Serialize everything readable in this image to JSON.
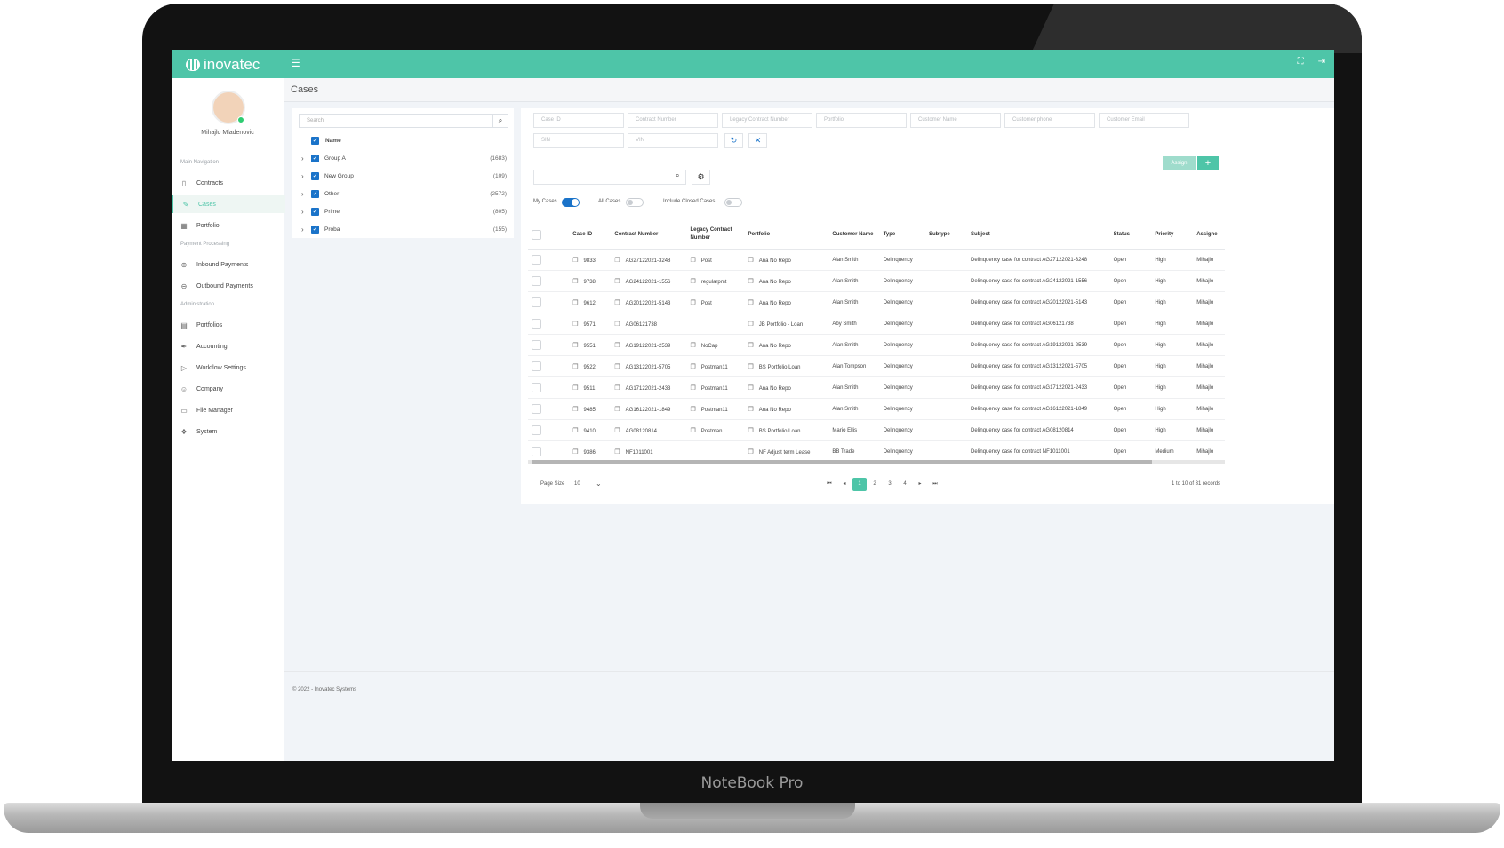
{
  "device": {
    "brand_label": "NoteBook Pro"
  },
  "app": {
    "logo": "inovatec",
    "page_title": "Cases",
    "footer": "© 2022 - Inovatec Systems"
  },
  "user": {
    "name": "Mihajlo Mladenovic"
  },
  "sidebar": {
    "sections": [
      {
        "title": "Main Navigation",
        "items": [
          {
            "label": "Contracts",
            "icon": "document-icon"
          },
          {
            "label": "Cases",
            "icon": "edit-icon"
          },
          {
            "label": "Portfolio",
            "icon": "grid-icon"
          }
        ]
      },
      {
        "title": "Payment Processing",
        "items": [
          {
            "label": "Inbound Payments",
            "icon": "plus-circle-icon"
          },
          {
            "label": "Outbound Payments",
            "icon": "minus-circle-icon"
          }
        ]
      },
      {
        "title": "Administration",
        "items": [
          {
            "label": "Portfolios",
            "icon": "folder-icon"
          },
          {
            "label": "Accounting",
            "icon": "pen-icon"
          },
          {
            "label": "Workflow Settings",
            "icon": "play-icon"
          },
          {
            "label": "Company",
            "icon": "people-icon"
          },
          {
            "label": "File Manager",
            "icon": "folder-open-icon"
          },
          {
            "label": "System",
            "icon": "tag-icon"
          }
        ]
      }
    ]
  },
  "tree": {
    "search_placeholder": "Search",
    "header": "Name",
    "groups": [
      {
        "name": "Group A",
        "count": "(1683)"
      },
      {
        "name": "New Group",
        "count": "(109)"
      },
      {
        "name": "Other",
        "count": "(2572)"
      },
      {
        "name": "Prime",
        "count": "(805)"
      },
      {
        "name": "Proba",
        "count": "(155)"
      }
    ]
  },
  "filters": {
    "case_id": "Case ID",
    "contract_number": "Contract Number",
    "legacy_contract_number": "Legacy Contract Number",
    "portfolio": "Portfolio",
    "customer_name": "Customer Name",
    "customer_phone": "Customer phone",
    "customer_email": "Customer Email",
    "sin": "SIN",
    "vin": "VIN"
  },
  "actions": {
    "assign": "Assign",
    "add": "+"
  },
  "toggles": {
    "my_cases": "My Cases",
    "all_cases": "All Cases",
    "include_closed": "Include Closed Cases"
  },
  "table": {
    "columns": [
      "Case ID",
      "Contract Number",
      "Legacy Contract Number",
      "Portfolio",
      "Customer Name",
      "Type",
      "Subtype",
      "Subject",
      "Status",
      "Priority",
      "Assigne"
    ],
    "rows": [
      {
        "id": "9833",
        "contract": "AG27122021-3248",
        "legacy": "Post",
        "portfolio": "Ana No Repo",
        "customer": "Alan Smith",
        "type": "Delinquency",
        "subtype": "",
        "subject": "Delinquency case for contract AG27122021-3248",
        "status": "Open",
        "priority": "High",
        "assignee": "Mihajlo"
      },
      {
        "id": "9738",
        "contract": "AG24122021-1556",
        "legacy": "regularpmt",
        "portfolio": "Ana No Repo",
        "customer": "Alan Smith",
        "type": "Delinquency",
        "subtype": "",
        "subject": "Delinquency case for contract AG24122021-1556",
        "status": "Open",
        "priority": "High",
        "assignee": "Mihajlo"
      },
      {
        "id": "9612",
        "contract": "AG20122021-5143",
        "legacy": "Post",
        "portfolio": "Ana No Repo",
        "customer": "Alan Smith",
        "type": "Delinquency",
        "subtype": "",
        "subject": "Delinquency case for contract AG20122021-5143",
        "status": "Open",
        "priority": "High",
        "assignee": "Mihajlo"
      },
      {
        "id": "9571",
        "contract": "AG06121738",
        "legacy": "",
        "portfolio": "JB Portfolio - Loan",
        "customer": "Aby Smith",
        "type": "Delinquency",
        "subtype": "",
        "subject": "Delinquency case for contract AG06121738",
        "status": "Open",
        "priority": "High",
        "assignee": "Mihajlo"
      },
      {
        "id": "9551",
        "contract": "AG19122021-2539",
        "legacy": "NoCap",
        "portfolio": "Ana No Repo",
        "customer": "Alan Smith",
        "type": "Delinquency",
        "subtype": "",
        "subject": "Delinquency case for contract AG19122021-2539",
        "status": "Open",
        "priority": "High",
        "assignee": "Mihajlo"
      },
      {
        "id": "9522",
        "contract": "AG13122021-5705",
        "legacy": "Postman11",
        "portfolio": "BS Portfolio Loan",
        "customer": "Alan Tompson",
        "type": "Delinquency",
        "subtype": "",
        "subject": "Delinquency case for contract AG13122021-5705",
        "status": "Open",
        "priority": "High",
        "assignee": "Mihajlo"
      },
      {
        "id": "9511",
        "contract": "AG17122021-2433",
        "legacy": "Postman11",
        "portfolio": "Ana No Repo",
        "customer": "Alan Smith",
        "type": "Delinquency",
        "subtype": "",
        "subject": "Delinquency case for contract AG17122021-2433",
        "status": "Open",
        "priority": "High",
        "assignee": "Mihajlo"
      },
      {
        "id": "9485",
        "contract": "AG16122021-1849",
        "legacy": "Postman11",
        "portfolio": "Ana No Repo",
        "customer": "Alan Smith",
        "type": "Delinquency",
        "subtype": "",
        "subject": "Delinquency case for contract AG16122021-1849",
        "status": "Open",
        "priority": "High",
        "assignee": "Mihajlo"
      },
      {
        "id": "9410",
        "contract": "AG08120814",
        "legacy": "Postman",
        "portfolio": "BS Portfolio Loan",
        "customer": "Mario Ellis",
        "type": "Delinquency",
        "subtype": "",
        "subject": "Delinquency case for contract AG08120814",
        "status": "Open",
        "priority": "High",
        "assignee": "Mihajlo"
      },
      {
        "id": "9386",
        "contract": "NF1011001",
        "legacy": "",
        "portfolio": "NF Adjust term Lease",
        "customer": "BB Trade",
        "type": "Delinquency",
        "subtype": "",
        "subject": "Delinquency case for contract NF1011001",
        "status": "Open",
        "priority": "Medium",
        "assignee": "Mihajlo"
      }
    ]
  },
  "pagination": {
    "page_size_label": "Page Size",
    "page_size": "10",
    "pages": [
      "1",
      "2",
      "3",
      "4"
    ],
    "current": "1",
    "records": "1 to 10 of 31 records"
  }
}
